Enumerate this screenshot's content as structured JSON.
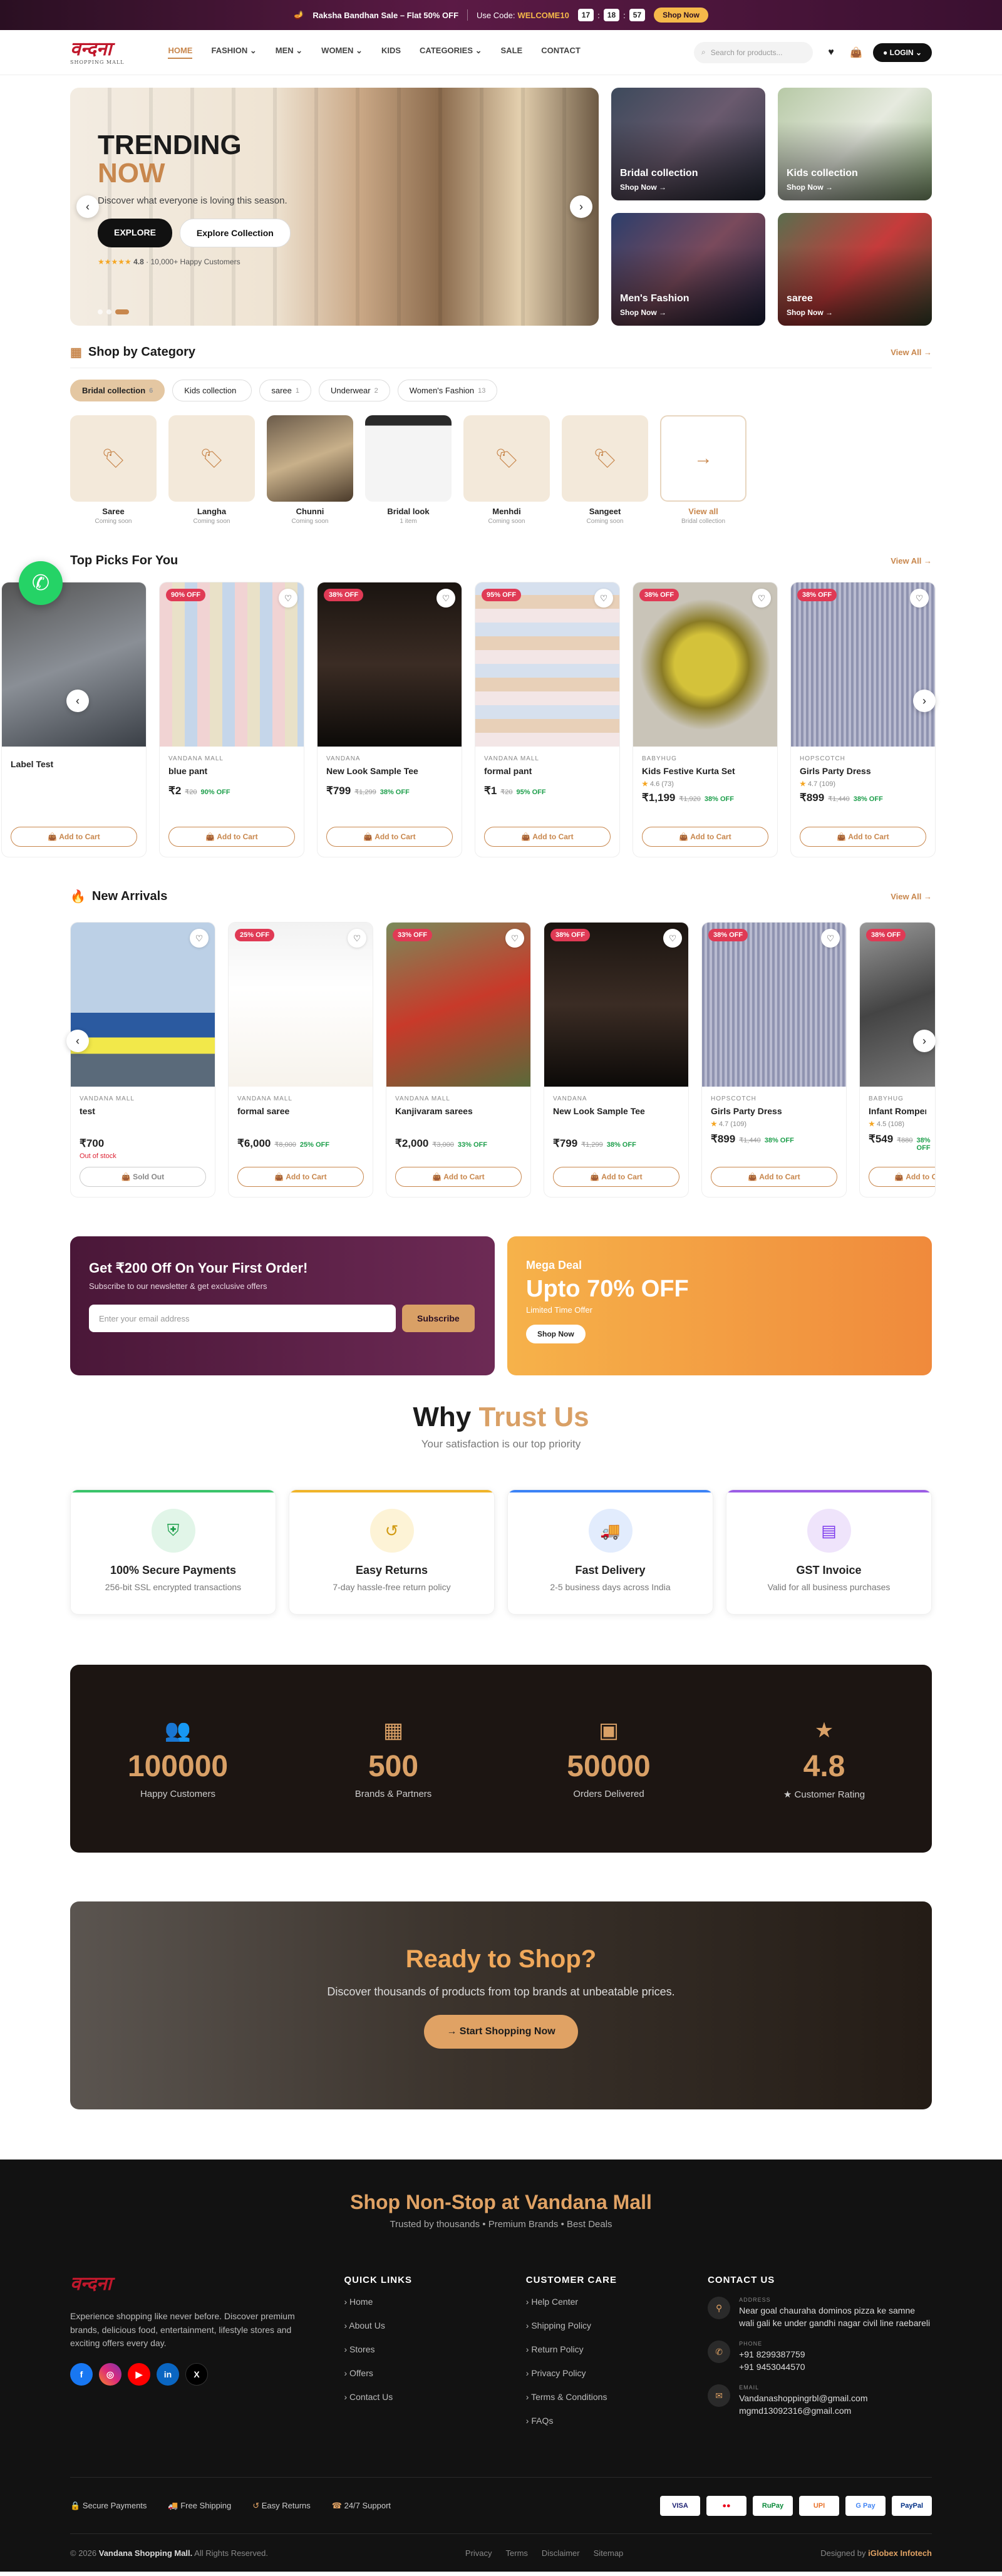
{
  "topbar": {
    "sale": "Raksha Bandhan Sale – Flat 50% OFF",
    "code_label": "Use Code:",
    "code": "WELCOME10",
    "timer": [
      "17",
      "18",
      "57"
    ],
    "cta": "Shop Now"
  },
  "header": {
    "logo_text": "वन्दना",
    "logo_sub": "SHOPPING MALL",
    "nav": [
      "HOME",
      "FASHION ⌄",
      "MEN ⌄",
      "WOMEN ⌄",
      "KIDS",
      "CATEGORIES ⌄",
      "SALE",
      "CONTACT"
    ],
    "search_placeholder": "Search for products...",
    "login": "LOGIN"
  },
  "hero": {
    "title1": "TRENDING",
    "title2": "NOW",
    "subtitle": "Discover what everyone is loving this season.",
    "btn1": "EXPLORE",
    "btn2": "Explore Collection",
    "rating": "4.8",
    "rating_text": "· 10,000+ Happy Customers",
    "tiles": [
      {
        "title": "Bridal collection",
        "cta": "Shop Now →"
      },
      {
        "title": "Kids collection",
        "cta": "Shop Now →"
      },
      {
        "title": "Men's Fashion",
        "cta": "Shop Now →"
      },
      {
        "title": "saree",
        "cta": "Shop Now →"
      }
    ]
  },
  "category": {
    "title": "Shop by Category",
    "view_all": "View All →",
    "chips": [
      {
        "label": "Bridal collection",
        "count": "6"
      },
      {
        "label": "Kids collection",
        "count": ""
      },
      {
        "label": "saree",
        "count": "1"
      },
      {
        "label": "Underwear",
        "count": "2"
      },
      {
        "label": "Women's Fashion",
        "count": "13"
      }
    ],
    "items": [
      {
        "name": "Saree",
        "sub": "Coming soon"
      },
      {
        "name": "Langha",
        "sub": "Coming soon"
      },
      {
        "name": "Chunni",
        "sub": "Coming soon"
      },
      {
        "name": "Bridal look",
        "sub": "1 item"
      },
      {
        "name": "Menhdi",
        "sub": "Coming soon"
      },
      {
        "name": "Sangeet",
        "sub": "Coming soon"
      },
      {
        "name": "View all",
        "sub": "Bridal collection"
      }
    ]
  },
  "top_picks": {
    "title": "Top Picks For You",
    "view_all": "View All →",
    "products": [
      {
        "discount": "",
        "brand": "",
        "name": "Label Test",
        "rating": "",
        "price": "",
        "old": "",
        "off": "",
        "cta": "Add to Cart"
      },
      {
        "discount": "90% OFF",
        "brand": "VANDANA MALL",
        "name": "blue pant",
        "rating": "",
        "price": "₹2",
        "old": "₹20",
        "off": "90% OFF",
        "cta": "Add to Cart"
      },
      {
        "discount": "38% OFF",
        "brand": "VANDANA",
        "name": "New Look Sample Tee",
        "rating": "",
        "price": "₹799",
        "old": "₹1,299",
        "off": "38% OFF",
        "cta": "Add to Cart"
      },
      {
        "discount": "95% OFF",
        "brand": "VANDANA MALL",
        "name": "formal pant",
        "rating": "",
        "price": "₹1",
        "old": "₹20",
        "off": "95% OFF",
        "cta": "Add to Cart"
      },
      {
        "discount": "38% OFF",
        "brand": "BABYHUG",
        "name": "Kids Festive Kurta Set",
        "rating": "4.6",
        "reviews": "(73)",
        "price": "₹1,199",
        "old": "₹1,920",
        "off": "38% OFF",
        "cta": "Add to Cart"
      },
      {
        "discount": "38% OFF",
        "brand": "HOPSCOTCH",
        "name": "Girls Party Dress",
        "rating": "4.7",
        "reviews": "(109)",
        "price": "₹899",
        "old": "₹1,440",
        "off": "38% OFF",
        "cta": "Add to Cart"
      }
    ]
  },
  "new_arrivals": {
    "title": "New Arrivals",
    "view_all": "View All →",
    "products": [
      {
        "discount": "",
        "brand": "VANDANA MALL",
        "name": "test",
        "rating": "",
        "price": "₹700",
        "old": "",
        "off": "",
        "stock": "Out of stock",
        "cta": "Sold Out"
      },
      {
        "discount": "25% OFF",
        "brand": "VANDANA MALL",
        "name": "formal saree",
        "rating": "",
        "price": "₹6,000",
        "old": "₹8,000",
        "off": "25% OFF",
        "stock": "",
        "cta": "Add to Cart"
      },
      {
        "discount": "33% OFF",
        "brand": "VANDANA MALL",
        "name": "Kanjivaram sarees",
        "rating": "",
        "price": "₹2,000",
        "old": "₹3,000",
        "off": "33% OFF",
        "stock": "",
        "cta": "Add to Cart"
      },
      {
        "discount": "38% OFF",
        "brand": "VANDANA",
        "name": "New Look Sample Tee",
        "rating": "",
        "price": "₹799",
        "old": "₹1,299",
        "off": "38% OFF",
        "stock": "",
        "cta": "Add to Cart"
      },
      {
        "discount": "38% OFF",
        "brand": "HOPSCOTCH",
        "name": "Girls Party Dress",
        "rating": "4.7",
        "reviews": "(109)",
        "price": "₹899",
        "old": "₹1,440",
        "off": "38% OFF",
        "stock": "",
        "cta": "Add to Cart"
      },
      {
        "discount": "38% OFF",
        "brand": "BABYHUG",
        "name": "Infant Romper",
        "rating": "4.5",
        "reviews": "(108)",
        "price": "₹549",
        "old": "₹880",
        "off": "38% OFF",
        "stock": "",
        "cta": "Add to Cart"
      }
    ]
  },
  "promo": {
    "newsletter_title": "Get ₹200 Off On Your First Order!",
    "newsletter_sub": "Subscribe to our newsletter & get exclusive offers",
    "email_placeholder": "Enter your email address",
    "subscribe": "Subscribe",
    "deal_label": "Mega Deal",
    "deal_title": "Upto 70% OFF",
    "deal_sub": "Limited Time Offer",
    "deal_cta": "Shop Now"
  },
  "why": {
    "title1": "Why",
    "title2": "Trust Us",
    "subtitle": "Your satisfaction is our top priority",
    "features": [
      {
        "title": "100% Secure Payments",
        "desc": "256-bit SSL encrypted transactions"
      },
      {
        "title": "Easy Returns",
        "desc": "7-day hassle-free return policy"
      },
      {
        "title": "Fast Delivery",
        "desc": "2-5 business days across India"
      },
      {
        "title": "GST Invoice",
        "desc": "Valid for all business purchases"
      }
    ]
  },
  "stats": [
    {
      "value": "100000",
      "label": "Happy Customers"
    },
    {
      "value": "500",
      "label": "Brands & Partners"
    },
    {
      "value": "50000",
      "label": "Orders Delivered"
    },
    {
      "value": "4.8",
      "label": "★ Customer Rating"
    }
  ],
  "ready": {
    "title1": "Ready to",
    "title2": "Shop?",
    "desc": "Discover thousands of products from top brands at unbeatable prices.",
    "cta": "Start Shopping Now"
  },
  "footer": {
    "title1": "Shop Non-Stop at",
    "title2": "Vandana Mall",
    "subtitle": "Trusted by thousands • Premium Brands • Best Deals",
    "about": "Experience shopping like never before. Discover premium brands, delicious food, entertainment, lifestyle stores and exciting offers every day.",
    "quick_title": "QUICK LINKS",
    "quick": [
      "Home",
      "About Us",
      "Stores",
      "Offers",
      "Contact Us"
    ],
    "care_title": "CUSTOMER CARE",
    "care": [
      "Help Center",
      "Shipping Policy",
      "Return Policy",
      "Privacy Policy",
      "Terms & Conditions",
      "FAQs"
    ],
    "contact_title": "CONTACT US",
    "address_label": "ADDRESS",
    "address": "Near goal chauraha dominos pizza ke samne wali gali ke under gandhi nagar civil line raebareli",
    "phone_label": "PHONE",
    "phone1": "+91 8299387759",
    "phone2": "+91 9453044570",
    "email_label": "EMAIL",
    "email1": "Vandanashoppingrbl@gmail.com",
    "email2": "mgmd13092316@gmail.com",
    "trust": [
      "Secure Payments",
      "Free Shipping",
      "Easy Returns",
      "24/7 Support"
    ],
    "payments": [
      "VISA",
      "●●",
      "RuPay",
      "UPI",
      "G Pay",
      "PayPal"
    ],
    "copyright_pre": "© 2026",
    "copyright_name": "Vandana Shopping Mall.",
    "copyright_post": "All Rights Reserved.",
    "links": [
      "Privacy",
      "Terms",
      "Disclaimer",
      "Sitemap"
    ],
    "designed_pre": "Designed by",
    "designed_by": "iGlobex Infotech"
  },
  "colors": {
    "accent": "#c8874d",
    "gold": "#d9a066",
    "discount": "#e03a55",
    "green": "#1c9e4a"
  }
}
